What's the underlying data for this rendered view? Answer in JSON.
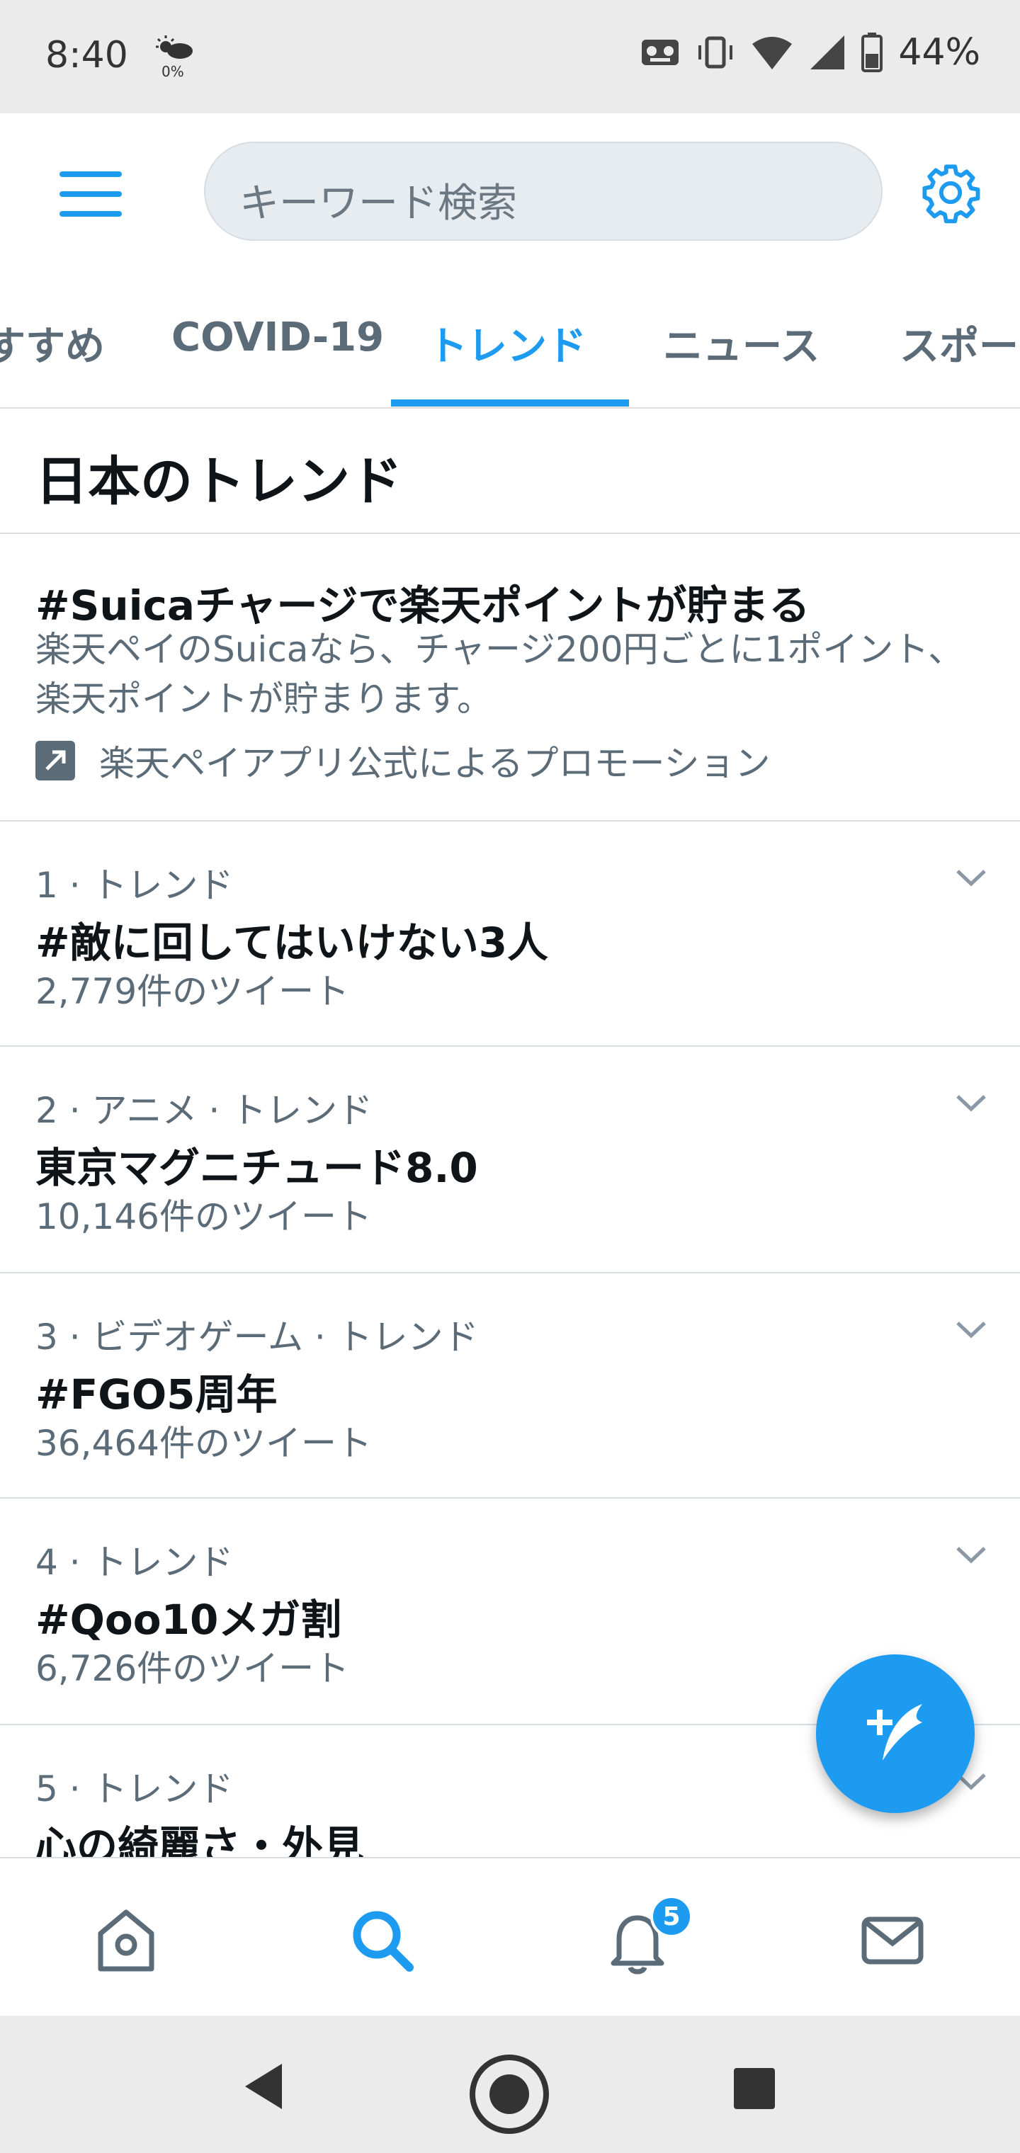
{
  "status_bar": {
    "time": "8:40",
    "weather_percent": "0%",
    "battery": "44%"
  },
  "search": {
    "placeholder": "キーワード検索"
  },
  "tabs": [
    {
      "label": "すすめ"
    },
    {
      "label": "COVID-19"
    },
    {
      "label": "トレンド",
      "active": true
    },
    {
      "label": "ニュース"
    },
    {
      "label": "スポー"
    }
  ],
  "section_title": "日本のトレンド",
  "promo": {
    "title": "#Suicaチャージで楽天ポイントが貯まる",
    "description_line1": "楽天ペイのSuicaなら、チャージ200円ごとに1ポイント、",
    "description_line2": "楽天ポイントが貯まります。",
    "source": "楽天ペイアプリ公式によるプロモーション"
  },
  "trends": [
    {
      "meta": "1 · トレンド",
      "name": "#敵に回してはいけない3人",
      "count": "2,779件のツイート"
    },
    {
      "meta": "2 · アニメ · トレンド",
      "name": "東京マグニチュード8.0",
      "count": "10,146件のツイート"
    },
    {
      "meta": "3 · ビデオゲーム · トレンド",
      "name": "#FGO5周年",
      "count": "36,464件のツイート"
    },
    {
      "meta": "4 · トレンド",
      "name": "#Qoo10メガ割",
      "count": "6,726件のツイート"
    },
    {
      "meta": "5 · トレンド",
      "name": "心の綺麗さ・外見",
      "count": ""
    }
  ],
  "bottom_nav": {
    "notification_badge": "5"
  },
  "colors": {
    "accent": "#1d9bf0",
    "text_primary": "#0f1419",
    "text_secondary": "#5b6b78",
    "divider": "#d9dde0"
  }
}
